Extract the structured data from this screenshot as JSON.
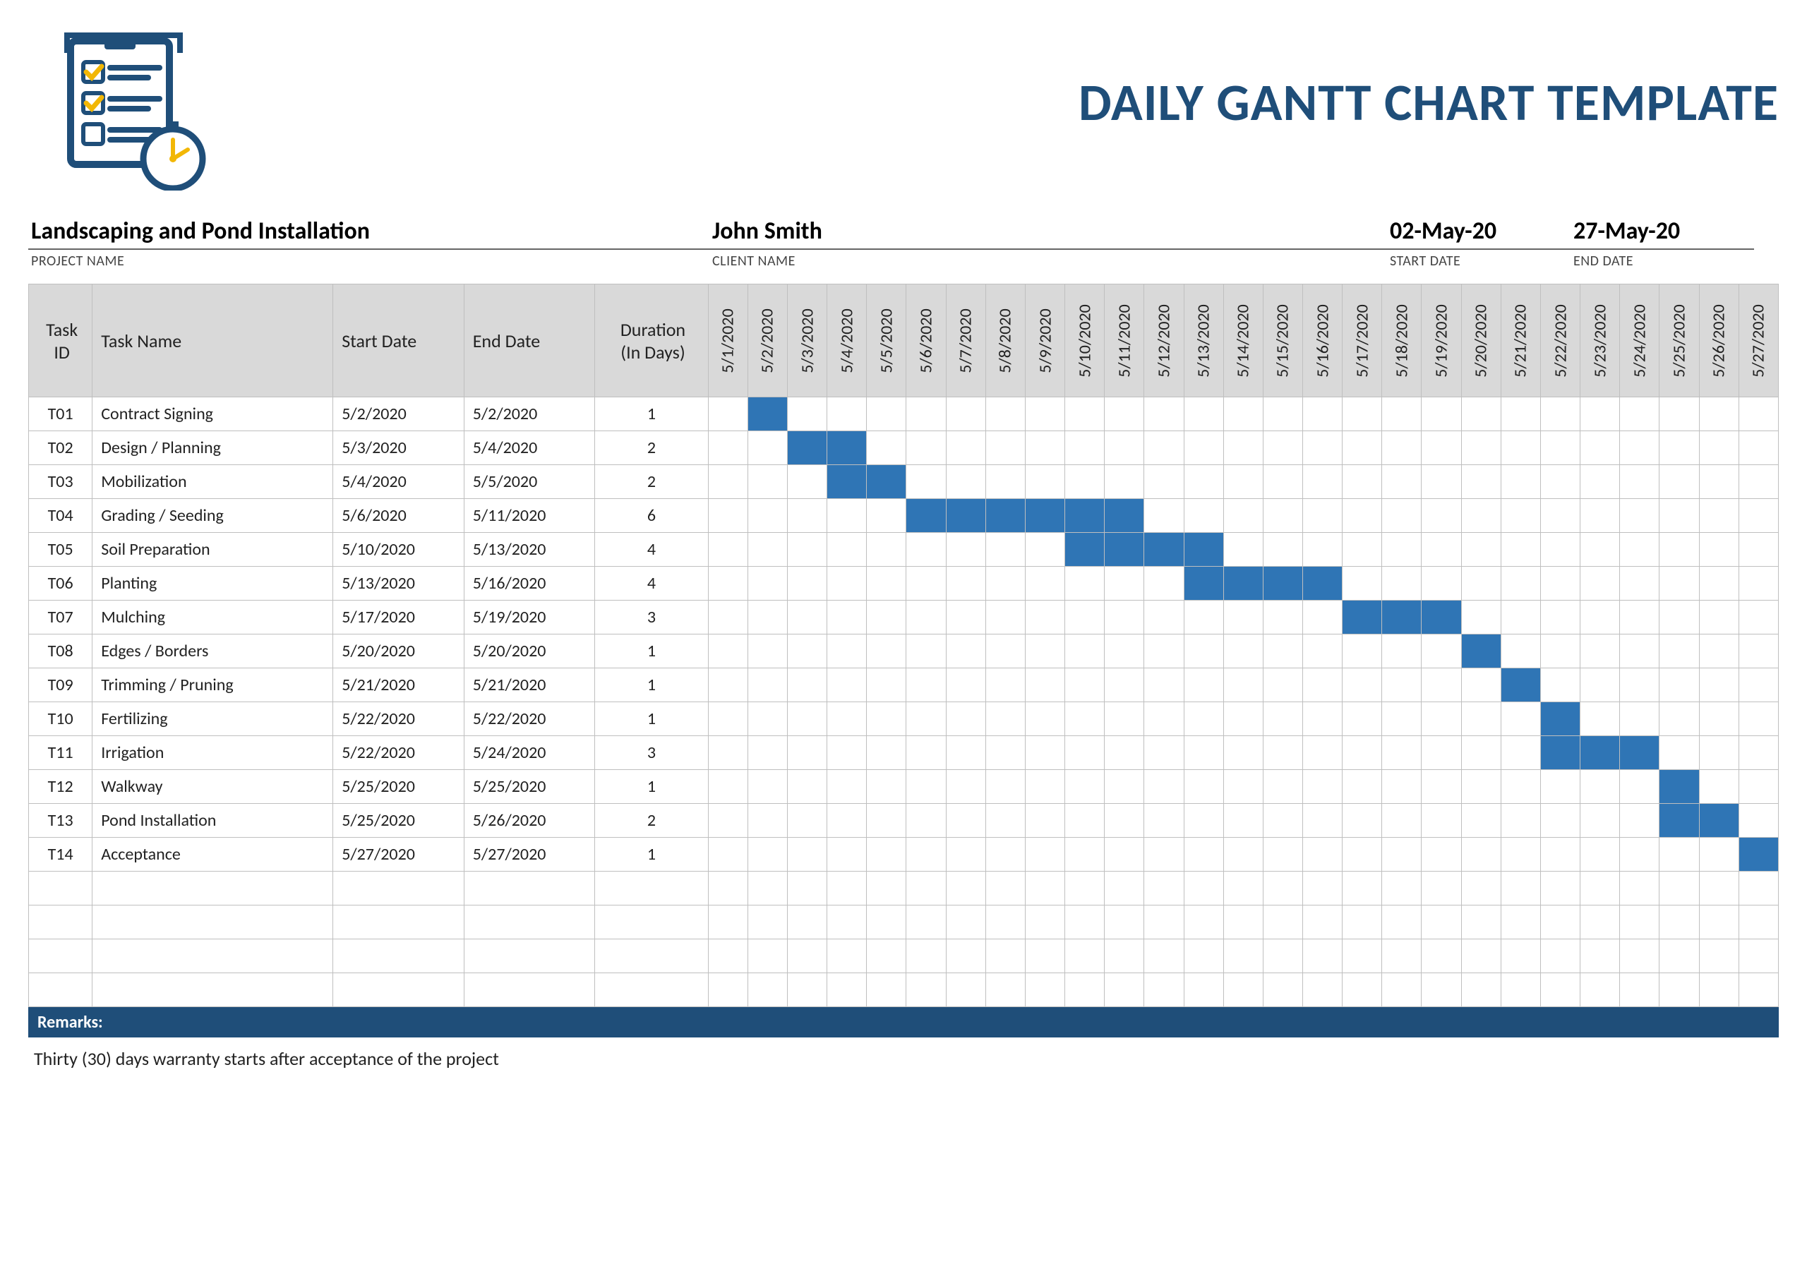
{
  "title": "DAILY GANTT CHART TEMPLATE",
  "meta": {
    "project_value": "Landscaping and Pond Installation",
    "project_label": "PROJECT NAME",
    "client_value": "John Smith",
    "client_label": "CLIENT NAME",
    "start_value": "02-May-20",
    "start_label": "START DATE",
    "end_value": "27-May-20",
    "end_label": "END DATE"
  },
  "columns": {
    "id": "Task ID",
    "name": "Task Name",
    "start": "Start Date",
    "end": "End Date",
    "duration_l1": "Duration",
    "duration_l2": "(In Days)"
  },
  "remarks_label": "Remarks:",
  "remarks_text": "Thirty (30) days warranty starts after acceptance of the project",
  "chart_data": {
    "type": "gantt",
    "title": "DAILY GANTT CHART TEMPLATE",
    "date_axis_start": "5/1/2020",
    "date_axis_end": "5/27/2020",
    "dates": [
      "5/1/2020",
      "5/2/2020",
      "5/3/2020",
      "5/4/2020",
      "5/5/2020",
      "5/6/2020",
      "5/7/2020",
      "5/8/2020",
      "5/9/2020",
      "5/10/2020",
      "5/11/2020",
      "5/12/2020",
      "5/13/2020",
      "5/14/2020",
      "5/15/2020",
      "5/16/2020",
      "5/17/2020",
      "5/18/2020",
      "5/19/2020",
      "5/20/2020",
      "5/21/2020",
      "5/22/2020",
      "5/23/2020",
      "5/24/2020",
      "5/25/2020",
      "5/26/2020",
      "5/27/2020"
    ],
    "empty_rows_after": 4,
    "tasks": [
      {
        "id": "T01",
        "name": "Contract Signing",
        "start": "5/2/2020",
        "end": "5/2/2020",
        "duration": 1,
        "start_idx": 1,
        "end_idx": 1
      },
      {
        "id": "T02",
        "name": "Design / Planning",
        "start": "5/3/2020",
        "end": "5/4/2020",
        "duration": 2,
        "start_idx": 2,
        "end_idx": 3
      },
      {
        "id": "T03",
        "name": "Mobilization",
        "start": "5/4/2020",
        "end": "5/5/2020",
        "duration": 2,
        "start_idx": 3,
        "end_idx": 4
      },
      {
        "id": "T04",
        "name": "Grading / Seeding",
        "start": "5/6/2020",
        "end": "5/11/2020",
        "duration": 6,
        "start_idx": 5,
        "end_idx": 10
      },
      {
        "id": "T05",
        "name": "Soil Preparation",
        "start": "5/10/2020",
        "end": "5/13/2020",
        "duration": 4,
        "start_idx": 9,
        "end_idx": 12
      },
      {
        "id": "T06",
        "name": "Planting",
        "start": "5/13/2020",
        "end": "5/16/2020",
        "duration": 4,
        "start_idx": 12,
        "end_idx": 15
      },
      {
        "id": "T07",
        "name": "Mulching",
        "start": "5/17/2020",
        "end": "5/19/2020",
        "duration": 3,
        "start_idx": 16,
        "end_idx": 18
      },
      {
        "id": "T08",
        "name": "Edges / Borders",
        "start": "5/20/2020",
        "end": "5/20/2020",
        "duration": 1,
        "start_idx": 19,
        "end_idx": 19
      },
      {
        "id": "T09",
        "name": "Trimming / Pruning",
        "start": "5/21/2020",
        "end": "5/21/2020",
        "duration": 1,
        "start_idx": 20,
        "end_idx": 20
      },
      {
        "id": "T10",
        "name": "Fertilizing",
        "start": "5/22/2020",
        "end": "5/22/2020",
        "duration": 1,
        "start_idx": 21,
        "end_idx": 21
      },
      {
        "id": "T11",
        "name": "Irrigation",
        "start": "5/22/2020",
        "end": "5/24/2020",
        "duration": 3,
        "start_idx": 21,
        "end_idx": 23
      },
      {
        "id": "T12",
        "name": "Walkway",
        "start": "5/25/2020",
        "end": "5/25/2020",
        "duration": 1,
        "start_idx": 24,
        "end_idx": 24
      },
      {
        "id": "T13",
        "name": "Pond Installation",
        "start": "5/25/2020",
        "end": "5/26/2020",
        "duration": 2,
        "start_idx": 24,
        "end_idx": 25
      },
      {
        "id": "T14",
        "name": "Acceptance",
        "start": "5/27/2020",
        "end": "5/27/2020",
        "duration": 1,
        "start_idx": 26,
        "end_idx": 26
      }
    ]
  }
}
